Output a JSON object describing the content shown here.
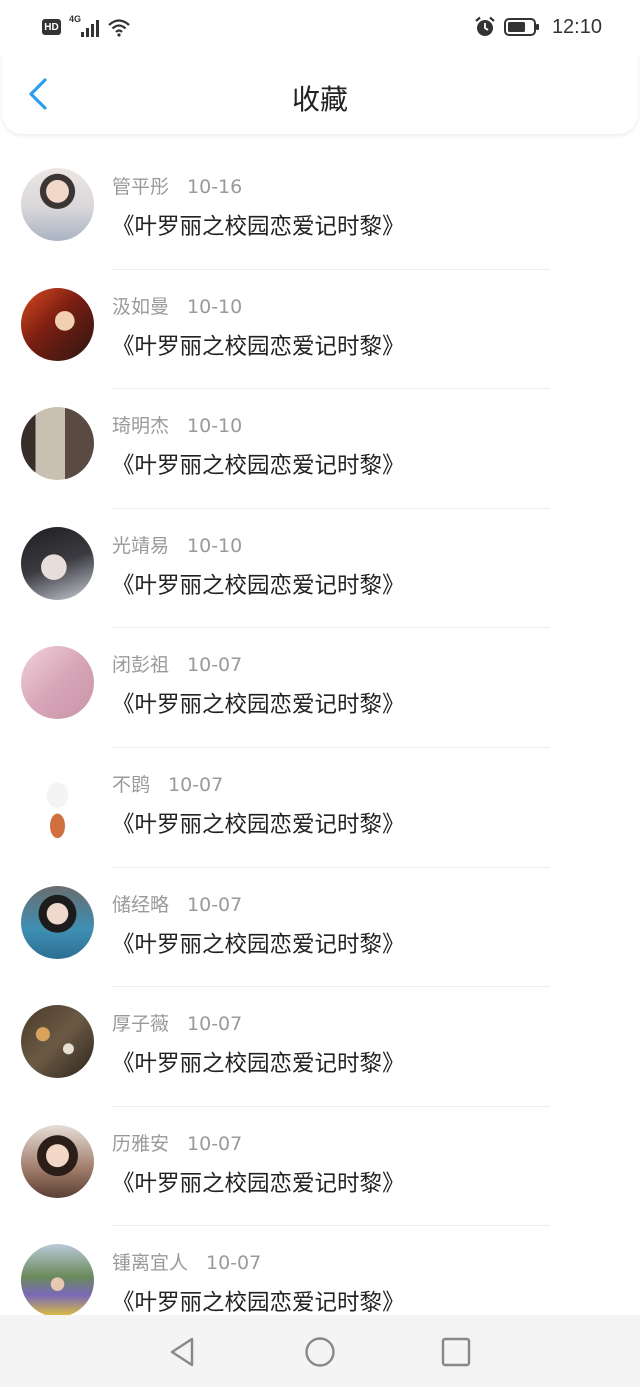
{
  "status": {
    "time": "12:10",
    "hd_label": "HD",
    "network_label": "4G"
  },
  "header": {
    "title": "收藏"
  },
  "items": [
    {
      "name": "管平彤",
      "date": "10-16",
      "title": "《叶罗丽之校园恋爱记时黎》",
      "avatar": "avatar-1"
    },
    {
      "name": "汲如曼",
      "date": "10-10",
      "title": "《叶罗丽之校园恋爱记时黎》",
      "avatar": "avatar-2"
    },
    {
      "name": "琦明杰",
      "date": "10-10",
      "title": "《叶罗丽之校园恋爱记时黎》",
      "avatar": "avatar-3"
    },
    {
      "name": "光靖易",
      "date": "10-10",
      "title": "《叶罗丽之校园恋爱记时黎》",
      "avatar": "avatar-4"
    },
    {
      "name": "闭彭祖",
      "date": "10-07",
      "title": "《叶罗丽之校园恋爱记时黎》",
      "avatar": "avatar-5"
    },
    {
      "name": "不鹍",
      "date": "10-07",
      "title": "《叶罗丽之校园恋爱记时黎》",
      "avatar": "avatar-6"
    },
    {
      "name": "储经略",
      "date": "10-07",
      "title": "《叶罗丽之校园恋爱记时黎》",
      "avatar": "avatar-7"
    },
    {
      "name": "厚子薇",
      "date": "10-07",
      "title": "《叶罗丽之校园恋爱记时黎》",
      "avatar": "avatar-8"
    },
    {
      "name": "历雅安",
      "date": "10-07",
      "title": "《叶罗丽之校园恋爱记时黎》",
      "avatar": "avatar-9"
    },
    {
      "name": "锺离宜人",
      "date": "10-07",
      "title": "《叶罗丽之校园恋爱记时黎》",
      "avatar": "avatar-10"
    }
  ],
  "icons": {
    "back": "chevron-left-icon",
    "nav_back": "triangle-back-icon",
    "nav_home": "circle-home-icon",
    "nav_recent": "square-recent-icon"
  },
  "colors": {
    "accent": "#2c9ef0",
    "text_primary": "#222222",
    "text_secondary": "#9a9a9a"
  }
}
